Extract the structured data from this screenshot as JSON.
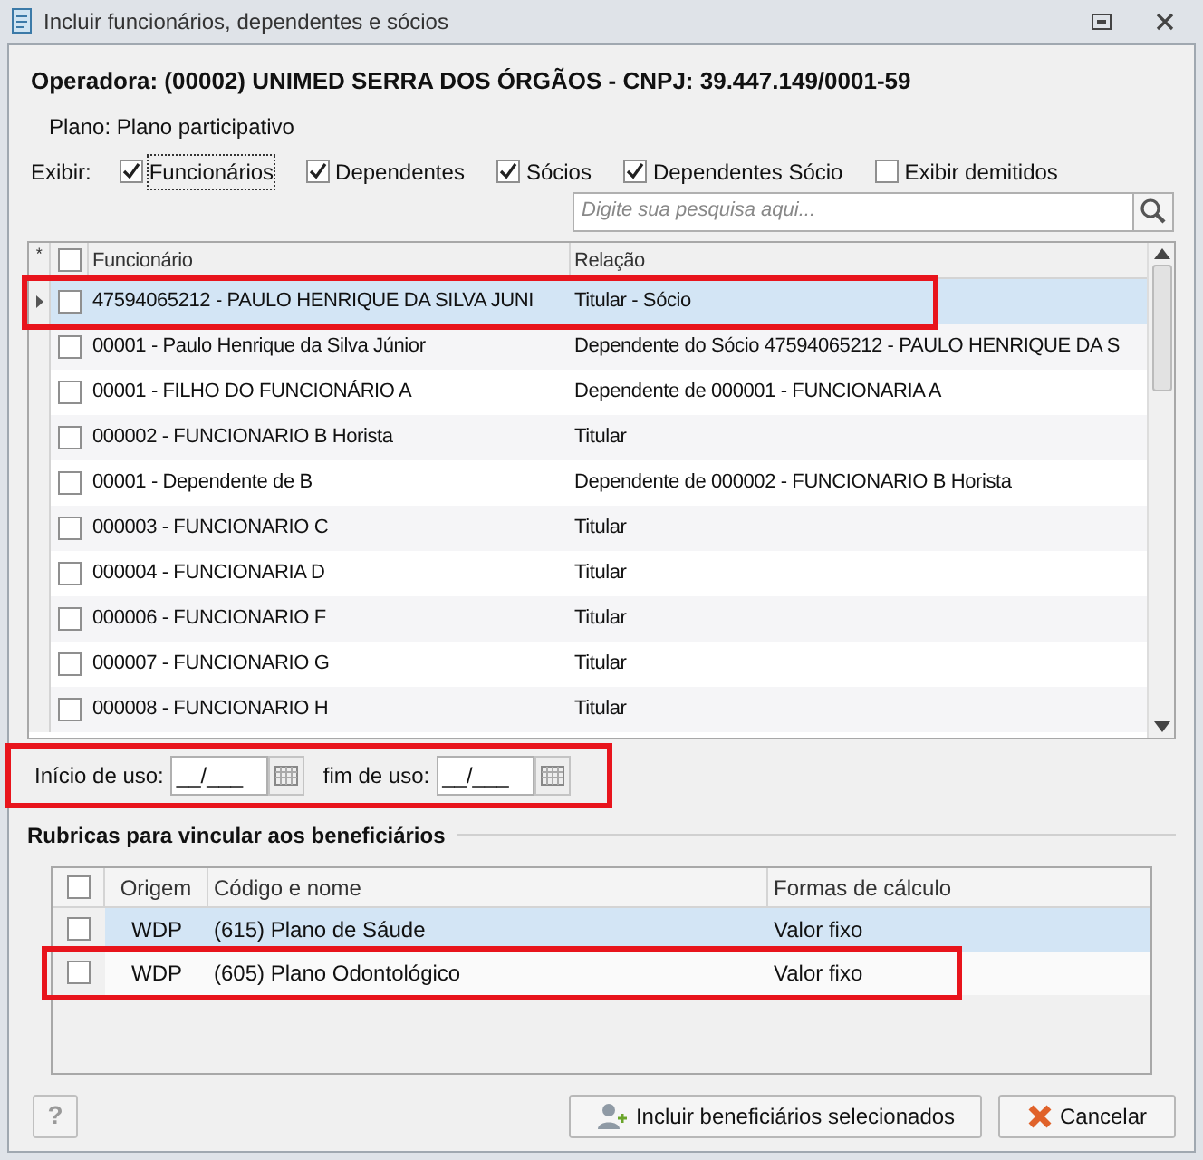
{
  "window": {
    "title": "Incluir funcionários, dependentes e sócios"
  },
  "operadora": "Operadora: (00002) UNIMED SERRA DOS ÓRGÃOS - CNPJ: 39.447.149/0001-59",
  "plano": "Plano: Plano participativo",
  "filter_label": "Exibir:",
  "filters": [
    {
      "label": "Funcionários",
      "checked": true,
      "focused": true
    },
    {
      "label": "Dependentes",
      "checked": true,
      "focused": false
    },
    {
      "label": "Sócios",
      "checked": true,
      "focused": false
    },
    {
      "label": "Dependentes Sócio",
      "checked": true,
      "focused": false
    },
    {
      "label": "Exibir demitidos",
      "checked": false,
      "focused": false
    }
  ],
  "search": {
    "placeholder": "Digite sua pesquisa aqui..."
  },
  "employees": {
    "new_row_mark": "*",
    "header_checked": false,
    "columns": [
      "Funcionário",
      "Relação"
    ],
    "rows": [
      {
        "name": "47594065212 - PAULO HENRIQUE DA SILVA JUNI",
        "relation": "Titular - Sócio",
        "selected": true,
        "checked": false,
        "highlight": true
      },
      {
        "name": "00001 - Paulo Henrique da Silva Júnior",
        "relation": "Dependente do Sócio 47594065212 - PAULO HENRIQUE DA S",
        "selected": false,
        "checked": false,
        "highlight": false
      },
      {
        "name": "00001 - FILHO DO FUNCIONÁRIO A",
        "relation": "Dependente de 000001 - FUNCIONARIA A",
        "selected": false,
        "checked": false,
        "highlight": false
      },
      {
        "name": "000002 - FUNCIONARIO  B Horista",
        "relation": "Titular",
        "selected": false,
        "checked": false,
        "highlight": false
      },
      {
        "name": "00001 - Dependente de B",
        "relation": "Dependente de 000002 - FUNCIONARIO  B Horista",
        "selected": false,
        "checked": false,
        "highlight": false
      },
      {
        "name": "000003 - FUNCIONARIO C",
        "relation": "Titular",
        "selected": false,
        "checked": false,
        "highlight": false
      },
      {
        "name": "000004 - FUNCIONARIA D",
        "relation": "Titular",
        "selected": false,
        "checked": false,
        "highlight": false
      },
      {
        "name": "000006 - FUNCIONARIO F",
        "relation": "Titular",
        "selected": false,
        "checked": false,
        "highlight": false
      },
      {
        "name": "000007 - FUNCIONARIO G",
        "relation": "Titular",
        "selected": false,
        "checked": false,
        "highlight": false
      },
      {
        "name": "000008 - FUNCIONARIO H",
        "relation": "Titular",
        "selected": false,
        "checked": false,
        "highlight": false
      }
    ]
  },
  "dates": {
    "highlight": true,
    "fields": [
      {
        "label": "Início de uso:",
        "value": "__/___"
      },
      {
        "label": "fim de uso:",
        "value": "__/___"
      }
    ]
  },
  "rubricas": {
    "title": "Rubricas para vincular aos beneficiários",
    "header_checked": false,
    "columns": [
      "Origem",
      "Código e nome",
      "Formas de cálculo"
    ],
    "rows": [
      {
        "origem": "WDP",
        "codigo": "(615) Plano de Sáude",
        "forma": "Valor fixo",
        "selected": true,
        "checked": false,
        "highlight": false
      },
      {
        "origem": "WDP",
        "codigo": "(605) Plano Odontológico",
        "forma": "Valor fixo",
        "selected": false,
        "checked": false,
        "highlight": true
      }
    ]
  },
  "help_button": "?",
  "buttons": [
    {
      "kind": "include",
      "label": "Incluir beneficiários selecionados"
    },
    {
      "kind": "cancel",
      "label": "Cancelar"
    }
  ]
}
